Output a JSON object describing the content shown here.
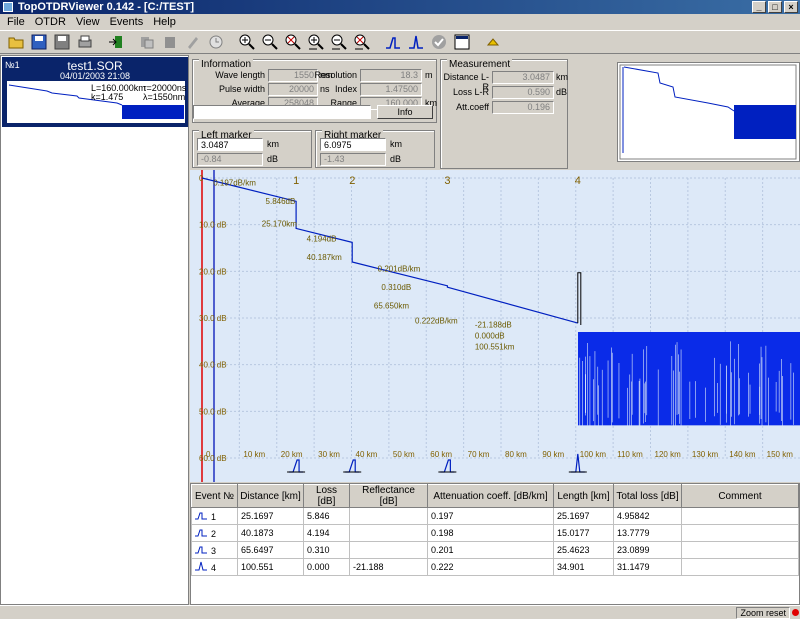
{
  "window": {
    "title": "TopOTDRViewer 0.142 - [C:/TEST]"
  },
  "menu": [
    "File",
    "OTDR",
    "View",
    "Events",
    "Help"
  ],
  "toolbar": [
    "open-icon",
    "save-icon",
    "save-as-icon",
    "print-icon",
    "export-icon",
    "copy-icon",
    "paste-icon",
    "edit-icon",
    "timer-icon",
    "zoom-in-icon",
    "zoom-out-icon",
    "zoom-fit-icon",
    "zoom-in-h-icon",
    "zoom-out-h-icon",
    "zoom-reset-icon",
    "event-step-icon",
    "event-peak-icon",
    "check-icon",
    "window-icon",
    "up-icon"
  ],
  "file": {
    "number": "№1",
    "name": "test1.SOR",
    "date": "04/01/2003 21:08",
    "thumb_l": "L=160.000km",
    "thumb_t": "τ=20000ns",
    "thumb_k": "k=1.475",
    "thumb_lambda": "λ=1550nm"
  },
  "info": {
    "legend": "Information",
    "wavelength_label": "Wave length",
    "wavelength": "1550",
    "wavelength_unit": "nm",
    "resolution_label": "Resolution",
    "resolution": "18.3",
    "resolution_unit": "m",
    "pulse_label": "Pulse width",
    "pulse": "20000",
    "pulse_unit": "ns",
    "index_label": "Index",
    "index": "1.47500",
    "average_label": "Average",
    "average": "258048",
    "range_label": "Range",
    "range": "160.000",
    "range_unit": "km",
    "info_button": "Info"
  },
  "measurement": {
    "legend": "Measurement",
    "distance_label": "Distance L-R",
    "distance": "3.0487",
    "distance_unit": "km",
    "loss_label": "Loss L-R",
    "loss": "0.590",
    "loss_unit": "dB",
    "att_label": "Att.coeff",
    "att": "0.196"
  },
  "left_marker": {
    "legend": "Left marker",
    "km": "3.0487",
    "km_unit": "km",
    "db": "-0.84",
    "db_unit": "dB"
  },
  "right_marker": {
    "legend": "Right marker",
    "km": "6.0975",
    "km_unit": "km",
    "db": "-1.43",
    "db_unit": "dB"
  },
  "graph": {
    "x_ticks": [
      "0",
      "10 km",
      "20 km",
      "30 km",
      "40 km",
      "50 km",
      "60 km",
      "70 km",
      "80 km",
      "90 km",
      "100 km",
      "110 km",
      "120 km",
      "130 km",
      "140 km",
      "150 km"
    ],
    "y_ticks": [
      "0",
      "10.0 dB",
      "20.0 dB",
      "30.0 dB",
      "40.0 dB",
      "50.0 dB",
      "60.0 dB"
    ],
    "event_numbers": [
      "1",
      "2",
      "3",
      "4"
    ],
    "annotations": [
      "0.197dB/km",
      "5.846dB",
      "25.170km",
      "4.194dB",
      "40.187km",
      "0.201dB/km",
      "0.310dB",
      "65.650km",
      "0.222dB/km",
      "-21.188dB",
      "0.000dB",
      "100.551km"
    ]
  },
  "table": {
    "headers": [
      "Event №",
      "Distance [km]",
      "Loss [dB]",
      "Reflectance [dB]",
      "Attenuation coeff. [dB/km]",
      "Length [km]",
      "Total loss [dB]",
      "Comment"
    ],
    "rows": [
      [
        "1",
        "25.1697",
        "5.846",
        "",
        "0.197",
        "25.1697",
        "4.95842",
        ""
      ],
      [
        "2",
        "40.1873",
        "4.194",
        "",
        "0.198",
        "15.0177",
        "13.7779",
        ""
      ],
      [
        "3",
        "65.6497",
        "0.310",
        "",
        "0.201",
        "25.4623",
        "23.0899",
        ""
      ],
      [
        "4",
        "100.551",
        "0.000",
        "-21.188",
        "0.222",
        "34.901",
        "31.1479",
        ""
      ]
    ]
  },
  "status": {
    "zoom_reset": "Zoom reset"
  },
  "chart_data": {
    "type": "line",
    "title": "",
    "xlabel": "",
    "ylabel": "",
    "xlim": [
      0,
      160
    ],
    "ylim": [
      0,
      60
    ],
    "series": [
      {
        "x": [
          0,
          25.17,
          25.17,
          40.19,
          40.19,
          65.65,
          65.65,
          100.55
        ],
        "values": [
          0,
          5.0,
          10.8,
          13.8,
          18.0,
          23.1,
          23.4,
          31.1
        ]
      }
    ],
    "noise_floor_from_km": 100.6,
    "events_km": [
      25.17,
      40.19,
      65.65,
      100.55
    ]
  }
}
